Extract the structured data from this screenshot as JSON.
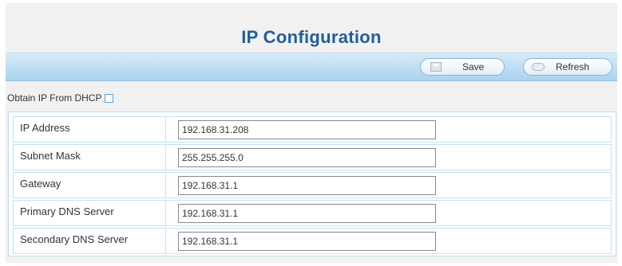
{
  "page": {
    "title": "IP Configuration"
  },
  "toolbar": {
    "save_label": "Save",
    "refresh_label": "Refresh"
  },
  "dhcp": {
    "label": "Obtain IP From DHCP",
    "checked": false
  },
  "fields": [
    {
      "label": "IP Address",
      "value": "192.168.31.208"
    },
    {
      "label": "Subnet Mask",
      "value": "255.255.255.0"
    },
    {
      "label": "Gateway",
      "value": "192.168.31.1"
    },
    {
      "label": "Primary DNS Server",
      "value": "192.168.31.1"
    },
    {
      "label": "Secondary DNS Server",
      "value": "192.168.31.1"
    }
  ],
  "colors": {
    "title": "#1f5f99",
    "toolbar": "#a9d3ef",
    "panel": "#f1f1f1"
  },
  "icons": {
    "save": "save-icon",
    "refresh": "refresh-icon"
  }
}
